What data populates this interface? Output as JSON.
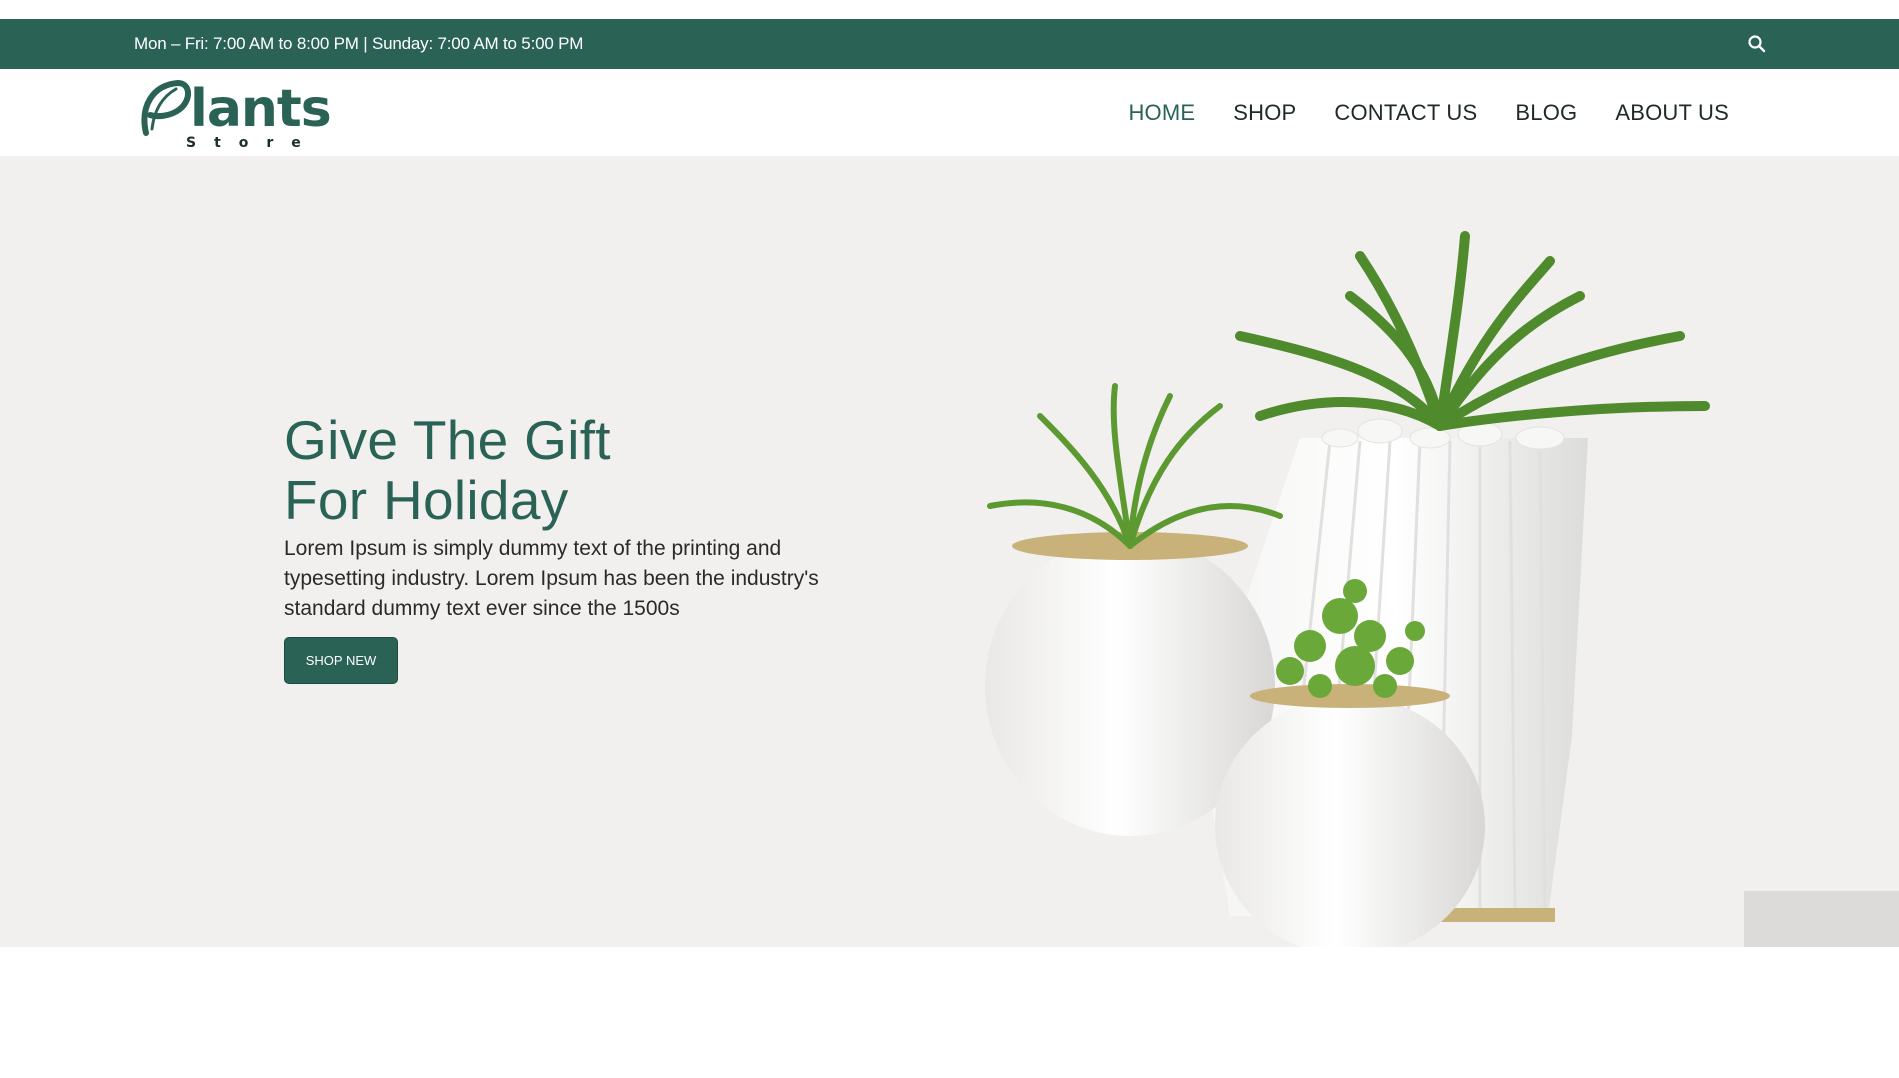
{
  "topbar": {
    "hours": "Mon – Fri: 7:00 AM to 8:00 PM | Sunday: 7:00 AM to 5:00 PM",
    "search_icon": "search-icon",
    "background": "#2a6355"
  },
  "logo": {
    "main": "Plants",
    "sub": "Store"
  },
  "nav": {
    "items": [
      "HOME",
      "SHOP",
      "CONTACT US",
      "BLOG",
      "ABOUT US"
    ],
    "active": "HOME"
  },
  "hero": {
    "title_line1": "Give The Gift",
    "title_line2": "For Holiday",
    "text": "Lorem Ipsum is simply dummy text of the printing and typesetting industry. Lorem Ipsum has been the industry's standard dummy text ever since the 1500s",
    "button": "SHOP NEW",
    "accent": "#2a6355"
  }
}
